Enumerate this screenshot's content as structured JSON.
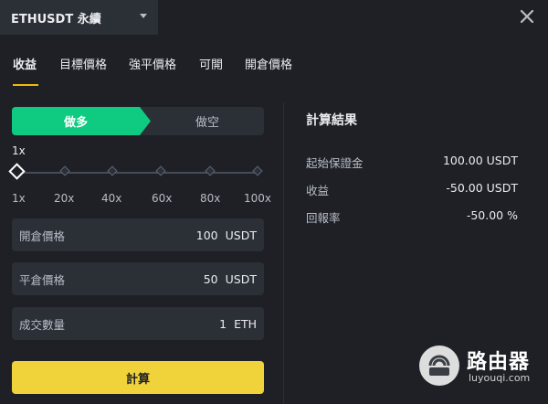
{
  "symbol": {
    "label": "ETHUSDT 永續"
  },
  "tabs": [
    {
      "label": "收益"
    },
    {
      "label": "目標價格"
    },
    {
      "label": "強平價格"
    },
    {
      "label": "可開"
    },
    {
      "label": "開倉價格"
    }
  ],
  "side": {
    "long_label": "做多",
    "short_label": "做空"
  },
  "leverage": {
    "current": "1x",
    "marks": [
      "1x",
      "20x",
      "40x",
      "60x",
      "80x",
      "100x"
    ],
    "value": 1
  },
  "fields": [
    {
      "label": "開倉價格",
      "value": "100",
      "unit": "USDT"
    },
    {
      "label": "平倉價格",
      "value": "50",
      "unit": "USDT"
    },
    {
      "label": "成交數量",
      "value": "1",
      "unit": "ETH"
    }
  ],
  "calc_button": {
    "label": "計算"
  },
  "results": {
    "title": "計算結果",
    "rows": [
      {
        "label": "起始保證金",
        "value": "100.00 USDT"
      },
      {
        "label": "收益",
        "value": "-50.00 USDT"
      },
      {
        "label": "回報率",
        "value": "-50.00 %"
      }
    ]
  },
  "watermark": {
    "name": "路由器",
    "url": "luyouqi.com"
  },
  "colors": {
    "long": "#0ecb81",
    "accent": "#f0b90b",
    "button": "#f0d33a",
    "background": "#1e2026"
  }
}
